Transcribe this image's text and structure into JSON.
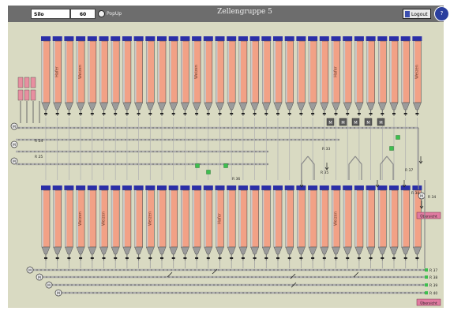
{
  "toolbar": {
    "silo_label": "Silo",
    "silo_value": "60",
    "pop_up_label": "PopUp",
    "title": "Zellengruppe 5",
    "logout_label": "Logout"
  },
  "upper_bin_names": [
    "Hafer",
    "Weizen",
    "Weizen",
    "Hafer",
    "Weizen"
  ],
  "lower_bin_names": [
    "Weizen",
    "Weizen",
    "Weizen",
    "Hafer",
    "Weizen"
  ],
  "conveyors": {
    "left": [
      "R 24",
      "R 25"
    ],
    "mid": [
      "R 33",
      "R 35",
      "R 36"
    ],
    "right": [
      "R 37",
      "R 38"
    ],
    "right_side": [
      "R 34",
      "R 37",
      "R 38",
      "R 39",
      "R 40"
    ]
  },
  "right_labels": {
    "r34": "R 34",
    "r37": "R 37",
    "r38": "R 38",
    "r39": "R 39",
    "r40": "R 40"
  },
  "buttons": {
    "ubersicht_top": "Übersicht",
    "ubersicht_bottom": "Übersicht"
  },
  "motor_label": "M",
  "colors": {
    "titlebar": "#6d6d6d",
    "canvas": "#d9dac2",
    "bin_fill": "#f2a186",
    "bin_header": "#2b2fa8",
    "pipe": "#a0a0a0",
    "accent_green": "#3dbf4e",
    "button_pink": "#e07aa0"
  }
}
